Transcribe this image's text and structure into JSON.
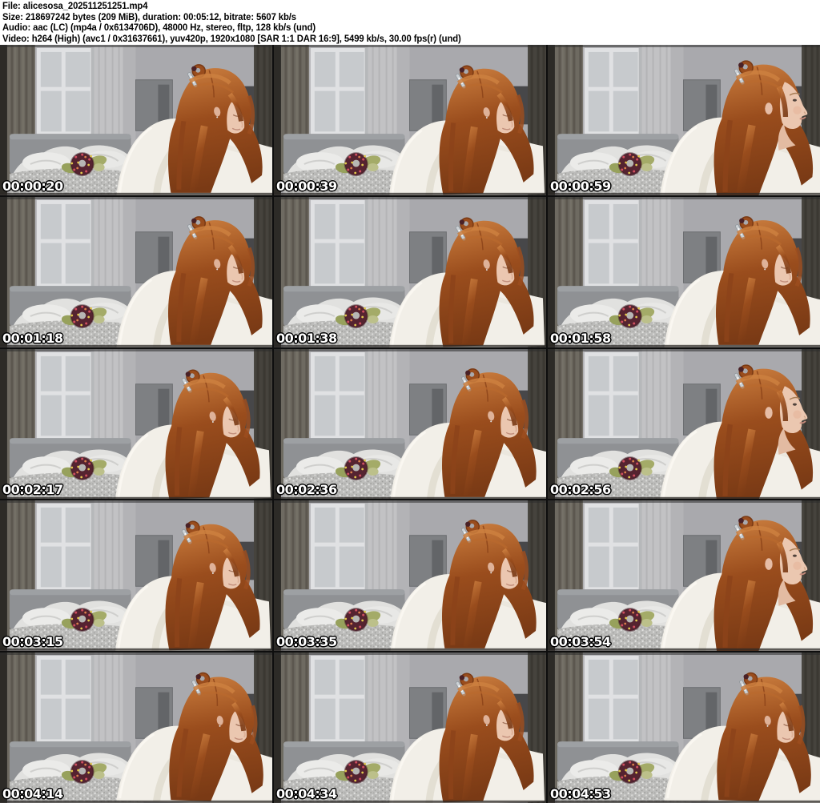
{
  "header": {
    "file_line": "File: alicesosa_202511251251.mp4",
    "size_line": "Size: 218697242 bytes (209 MiB), duration: 00:05:12, bitrate: 5607 kb/s",
    "audio_line": "Audio: aac (LC) (mp4a / 0x6134706D), 48000 Hz, stereo, fltp, 128 kb/s (und)",
    "video_line": "Video: h264 (High) (avc1 / 0x31637661), yuv420p, 1920x1080 [SAR 1:1 DAR 16:9], 5499 kb/s, 30.00 fps(r) (und)"
  },
  "grid": {
    "columns": 3,
    "rows": 5
  },
  "frames": [
    {
      "timestamp": "00:00:20",
      "pose": "head-down"
    },
    {
      "timestamp": "00:00:39",
      "pose": "head-down-alt"
    },
    {
      "timestamp": "00:00:59",
      "pose": "profile-right"
    },
    {
      "timestamp": "00:01:18",
      "pose": "head-down"
    },
    {
      "timestamp": "00:01:38",
      "pose": "head-down-alt"
    },
    {
      "timestamp": "00:01:58",
      "pose": "head-down"
    },
    {
      "timestamp": "00:02:17",
      "pose": "head-down-alt"
    },
    {
      "timestamp": "00:02:36",
      "pose": "head-down"
    },
    {
      "timestamp": "00:02:56",
      "pose": "profile-right"
    },
    {
      "timestamp": "00:03:15",
      "pose": "head-down-alt"
    },
    {
      "timestamp": "00:03:35",
      "pose": "head-down"
    },
    {
      "timestamp": "00:03:54",
      "pose": "profile-right"
    },
    {
      "timestamp": "00:04:14",
      "pose": "head-down-smile"
    },
    {
      "timestamp": "00:04:34",
      "pose": "head-down-alt"
    },
    {
      "timestamp": "00:04:53",
      "pose": "head-down-smile"
    }
  ],
  "scene": {
    "subject": "person with long auburn hair, silver hair clip and top bun, wearing a white fluffy sweater, leaning forward",
    "setting": "grey bedroom: bright window with sheer curtains left, dark curtain strips at both edges, grey headboard bed with white duvet, maroon crochet flower with green leaves, speckled sheet, wall mirror"
  },
  "colors": {
    "header_bg": "#ffffff",
    "header_fg": "#000000",
    "gap": "#0e0e0e",
    "ts_color": "#ffffff",
    "wall": "#a9a9ad",
    "wall_light": "#bbbbbe",
    "window_frame": "#e0e1e3",
    "window_pane": "#c7cacd",
    "curtain_left": "#6e6a61",
    "curtain_left_fold": "#57534b",
    "curtain_right": "#46433d",
    "headboard": "#8f9194",
    "bed_white": "#e1e1df",
    "sheet_base": "#bcbcba",
    "flower_maroon": "#552330",
    "flower_leaf": "#a4ab68",
    "hair_light": "#cd8040",
    "hair_mid": "#9a4d1d",
    "hair_dark": "#7a3a15",
    "sweater": "#f2efe8",
    "sweater_shadow": "#dad5c7",
    "skin": "#ebc7b0"
  }
}
